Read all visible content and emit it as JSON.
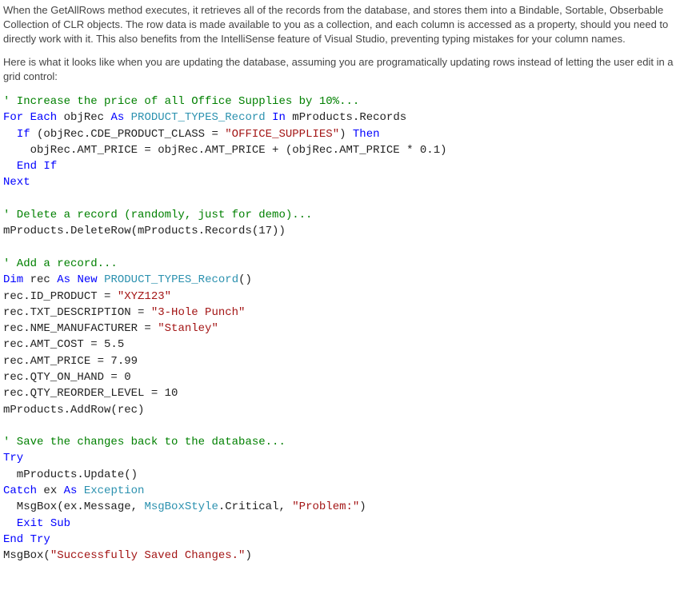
{
  "prose": {
    "p1": "When the GetAllRows method executes, it retrieves all of the records from the database, and stores them into a Bindable, Sortable, Obserbable Collection of CLR objects. The row data is made available to you as a collection, and each column is accessed as a property, should you need to directly work with it. This also benefits from the IntelliSense feature of Visual Studio, preventing typing mistakes for your column names.",
    "p2": "Here is what it looks like when you are updating the database, assuming you are programatically updating rows instead of letting the user edit in a grid control:"
  },
  "code": {
    "c01": "' Increase the price of all Office Supplies by 10%...",
    "c02a": "For Each",
    "c02b": " objRec ",
    "c02c": "As",
    "c02d": " ",
    "c02e": "PRODUCT_TYPES_Record",
    "c02f": " ",
    "c02g": "In",
    "c02h": " mProducts.Records",
    "c03a": "  ",
    "c03b": "If",
    "c03c": " (objRec.CDE_PRODUCT_CLASS = ",
    "c03d": "\"OFFICE_SUPPLIES\"",
    "c03e": ") ",
    "c03f": "Then",
    "c04": "    objRec.AMT_PRICE = objRec.AMT_PRICE + (objRec.AMT_PRICE * 0.1)",
    "c05a": "  ",
    "c05b": "End If",
    "c06": "Next",
    "c08": "' Delete a record (randomly, just for demo)...",
    "c09": "mProducts.DeleteRow(mProducts.Records(17))",
    "c11": "' Add a record...",
    "c12a": "Dim",
    "c12b": " rec ",
    "c12c": "As New",
    "c12d": " ",
    "c12e": "PRODUCT_TYPES_Record",
    "c12f": "()",
    "c13a": "rec.ID_PRODUCT = ",
    "c13b": "\"XYZ123\"",
    "c14a": "rec.TXT_DESCRIPTION = ",
    "c14b": "\"3-Hole Punch\"",
    "c15a": "rec.NME_MANUFACTURER = ",
    "c15b": "\"Stanley\"",
    "c16": "rec.AMT_COST = 5.5",
    "c17": "rec.AMT_PRICE = 7.99",
    "c18": "rec.QTY_ON_HAND = 0",
    "c19": "rec.QTY_REORDER_LEVEL = 10",
    "c20": "mProducts.AddRow(rec)",
    "c22": "' Save the changes back to the database...",
    "c23": "Try",
    "c24": "  mProducts.Update()",
    "c25a": "Catch",
    "c25b": " ex ",
    "c25c": "As",
    "c25d": " ",
    "c25e": "Exception",
    "c26a": "  MsgBox(ex.Message, ",
    "c26b": "MsgBoxStyle",
    "c26c": ".Critical, ",
    "c26d": "\"Problem:\"",
    "c26e": ")",
    "c27a": "  ",
    "c27b": "Exit Sub",
    "c28": "End Try",
    "c29a": "MsgBox(",
    "c29b": "\"Successfully Saved Changes.\"",
    "c29c": ")"
  }
}
